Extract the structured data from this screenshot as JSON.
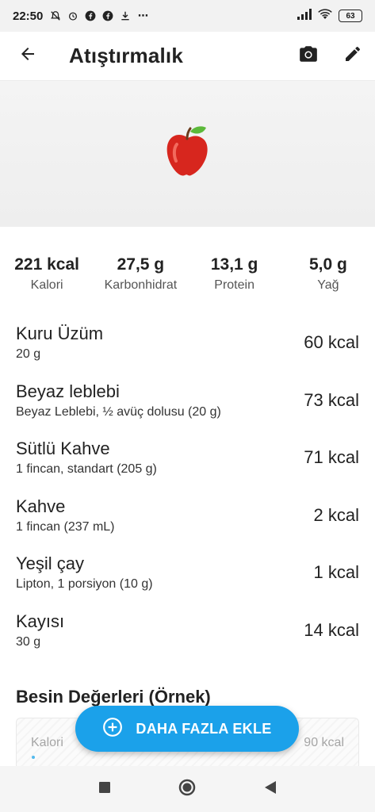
{
  "status_bar": {
    "time": "22:50",
    "battery": "63",
    "more": "⋯"
  },
  "app_bar": {
    "title": "Atıştırmalık",
    "icons": [
      "arrow-back-icon",
      "camera-icon",
      "edit-pencil-icon"
    ]
  },
  "hero": {
    "icon": "apple-icon",
    "glyph": "🍎"
  },
  "summary": [
    {
      "value": "221 kcal",
      "label": "Kalori"
    },
    {
      "value": "27,5 g",
      "label": "Karbonhidrat"
    },
    {
      "value": "13,1 g",
      "label": "Protein"
    },
    {
      "value": "5,0 g",
      "label": "Yağ"
    }
  ],
  "foods": [
    {
      "name": "Kuru Üzüm",
      "portion": "20 g",
      "kcal": "60 kcal"
    },
    {
      "name": "Beyaz leblebi",
      "portion": "Beyaz Leblebi, ½ avüç dolusu (20 g)",
      "kcal": "73 kcal"
    },
    {
      "name": "Sütlü Kahve",
      "portion": "1 fincan, standart (205 g)",
      "kcal": "71 kcal"
    },
    {
      "name": "Kahve",
      "portion": "1 fincan (237 mL)",
      "kcal": "2 kcal"
    },
    {
      "name": "Yeşil çay",
      "portion": "Lipton, 1 porsiyon (10 g)",
      "kcal": "1 kcal"
    },
    {
      "name": "Kayısı",
      "portion": "30 g",
      "kcal": "14 kcal"
    }
  ],
  "nutrition": {
    "title": "Besin Değerleri (Örnek)",
    "row_label": "Kalori",
    "row_value": "90 kcal"
  },
  "fab": {
    "label": "DAHA FAZLA EKLE",
    "icon": "add-circle-icon"
  },
  "nav": {
    "icons": [
      "recent-apps-icon",
      "home-icon",
      "back-triangle-icon"
    ]
  },
  "colors": {
    "accent": "#1ba1ea"
  }
}
